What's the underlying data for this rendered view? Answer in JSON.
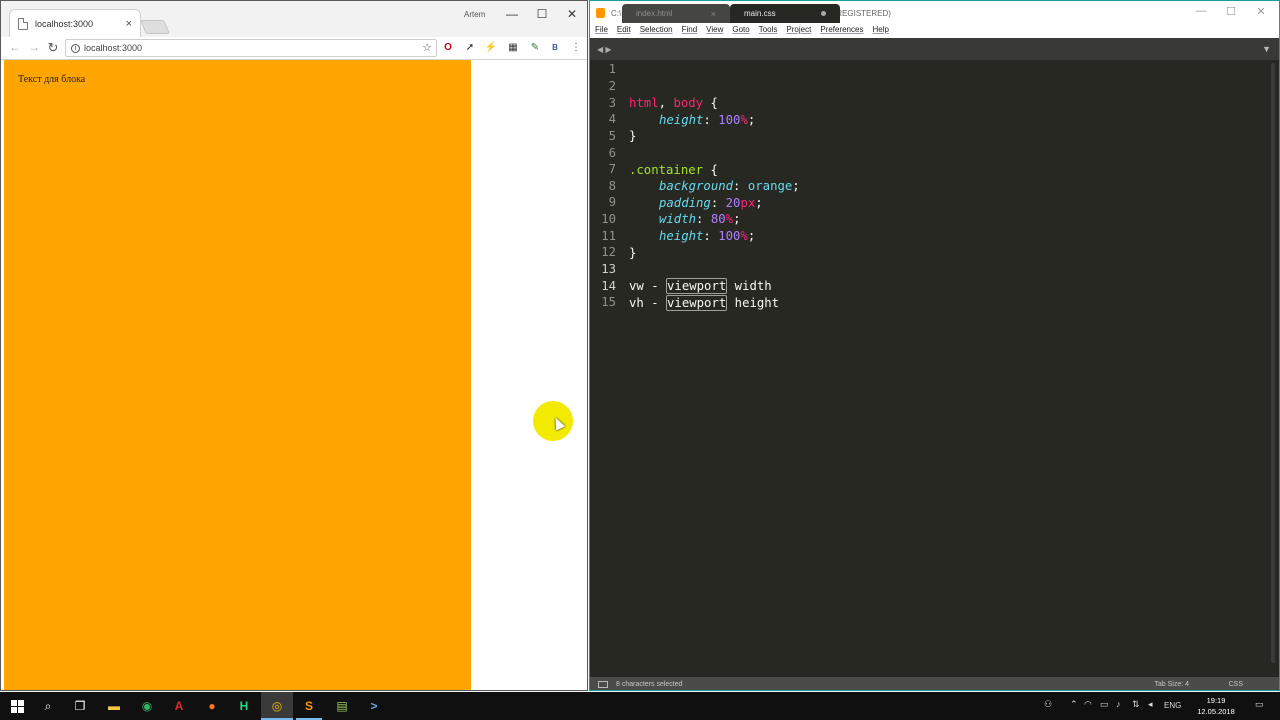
{
  "browser": {
    "tab_title": "localhost:3000",
    "tab_close": "×",
    "user_name": "Artem",
    "address": "localhost:3000",
    "info_glyph": "i",
    "star_glyph": "☆",
    "nav": {
      "back": "←",
      "forward": "→",
      "reload": "↻"
    },
    "window_controls": {
      "minimize": "—",
      "maximize": "☐",
      "close": "✕"
    },
    "extensions": [
      "opera-icon",
      "cursor-icon",
      "lightning-icon",
      "extension-badge-icon",
      "pen-icon",
      "b-icon",
      "menu-icon"
    ],
    "extension_glyphs": {
      "opera": "O",
      "cursor": "➚",
      "lightning": "⚡",
      "badge": "▦",
      "pen": "✎",
      "b": "B",
      "menu": "⋮"
    },
    "page": {
      "block_text": "Текст для блока",
      "block_color": "#ffa500"
    }
  },
  "editor": {
    "title": "C:\\Users\\Sawyer\\Desktop\\test\\app\\main.css - Sublime Text (UNREGISTERED)",
    "menu": [
      "File",
      "Edit",
      "Selection",
      "Find",
      "View",
      "Goto",
      "Tools",
      "Project",
      "Preferences",
      "Help"
    ],
    "tabs": [
      {
        "label": "index.html",
        "marker": "×"
      },
      {
        "label": "main.css",
        "marker": "●"
      }
    ],
    "arrows": "◀ ▶",
    "dropdown": "▼",
    "line_numbers": [
      "1",
      "2",
      "3",
      "4",
      "5",
      "6",
      "7",
      "8",
      "9",
      "10",
      "11",
      "12",
      "13",
      "14",
      "15"
    ],
    "code": {
      "l2": {
        "sel1": "html",
        "comma": ", ",
        "sel2": "body",
        "brace": " {"
      },
      "l3": {
        "prop": "height",
        "colon": ": ",
        "num": "100",
        "unit": "%",
        "semi": ";"
      },
      "l4": "}",
      "l6": {
        "sel": ".container",
        "brace": " {"
      },
      "l7": {
        "prop": "background",
        "colon": ": ",
        "val": "orange",
        "semi": ";"
      },
      "l8": {
        "prop": "padding",
        "colon": ": ",
        "num": "20",
        "unit": "px",
        "semi": ";"
      },
      "l9": {
        "prop": "width",
        "colon": ": ",
        "num": "80",
        "unit": "%",
        "semi": ";"
      },
      "l10": {
        "prop": "height",
        "colon": ": ",
        "num": "100",
        "unit": "%",
        "semi": ";"
      },
      "l11": "}",
      "l13": {
        "pre": "vw - ",
        "word": "viewport",
        "post": " width"
      },
      "l14": {
        "pre": "vh - ",
        "word": "viewport",
        "post": " height"
      }
    },
    "status": {
      "left": "8 characters selected",
      "tab_size": "Tab Size: 4",
      "syntax": "CSS"
    },
    "window_controls": {
      "minimize": "—",
      "maximize": "☐",
      "close": "✕"
    }
  },
  "taskbar": {
    "search_glyph": "⌕",
    "task_view_glyph": "❐",
    "apps": [
      "file-explorer-icon",
      "green-app-icon",
      "acrobat-icon",
      "firefox-icon",
      "intellij-icon",
      "chrome-icon",
      "sublime-icon",
      "notepad-icon",
      "powershell-icon"
    ],
    "app_glyphs": {
      "explorer": "▬",
      "green": "◉",
      "acrobat": "A",
      "firefox": "●",
      "intellij": "H",
      "chrome": "◎",
      "sublime": "S",
      "notepad": "▤",
      "powershell": ">"
    },
    "tray_glyphs": {
      "person": "⚇",
      "chevron": "⌃",
      "wifi": "◠",
      "battery": "▭",
      "volume": "♪",
      "network": "⇅",
      "speaker": "◂",
      "notifications": "▭"
    },
    "language": "ENG",
    "time": "19:19",
    "date": "12.05.2018"
  }
}
